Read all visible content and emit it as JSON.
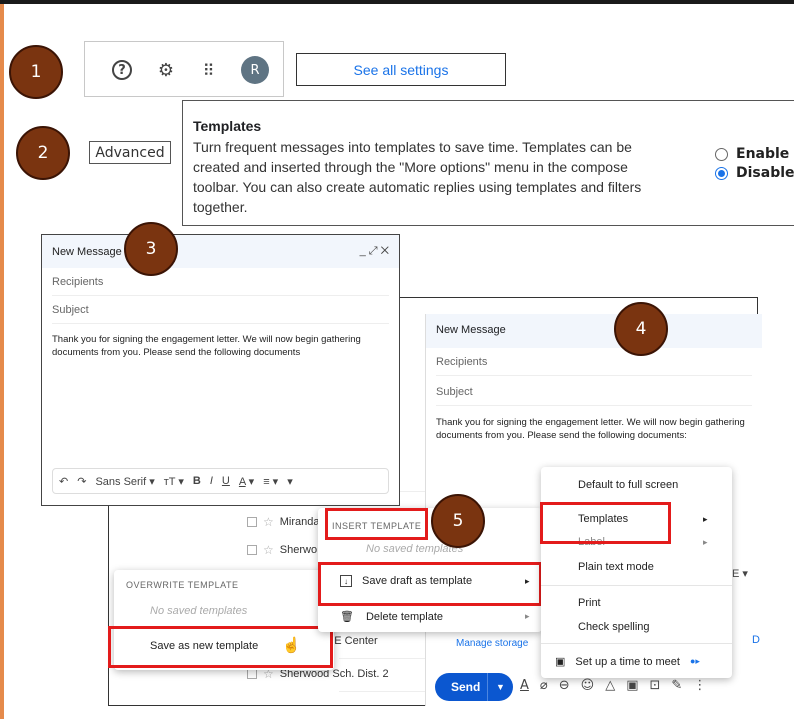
{
  "steps": [
    "1",
    "2",
    "3",
    "4",
    "5"
  ],
  "toolbar": {
    "avatar_letter": "R",
    "see_all_settings": "See all settings",
    "icons": [
      "help-icon",
      "gear-icon",
      "apps-grid-icon"
    ]
  },
  "settings": {
    "advanced_tab": "Advanced",
    "templates_title": "Templates",
    "templates_desc": "Turn frequent messages into templates to save time. Templates can be created and inserted through the \"More options\" menu in the compose toolbar. You can also create automatic replies using templates and filters together.",
    "enable_label": "Enable",
    "disable_label": "Disable",
    "selected": "Disable"
  },
  "compose": {
    "title": "New Message",
    "recipients_placeholder": "Recipients",
    "subject_placeholder": "Subject",
    "body": "Thank you for signing the engagement letter. We will now begin gathering documents from you. Please send the following documents",
    "body_full": "Thank you for signing the engagement letter. We will now begin gathering documents from you. Please send the following documents:",
    "window_controls": "_ ⤢ ✕",
    "format_toolbar": {
      "font": "Sans Serif",
      "bold": "B",
      "italic": "I",
      "underline": "U",
      "text_color": "A",
      "size": "тT"
    }
  },
  "inbox_list": {
    "rows": [
      "Miranda",
      "Sherwo",
      "ARE Center",
      "Sherwood Sch. Dist. 2"
    ]
  },
  "more_options_menu": {
    "items": [
      "Default to full screen",
      "Templates",
      "Label",
      "Plain text mode",
      "Print",
      "Check spelling",
      "Set up a time to meet"
    ]
  },
  "templates_menu": {
    "insert_header": "INSERT TEMPLATE",
    "insert_empty": "No saved templates",
    "save_draft": "Save draft as template",
    "delete_template": "Delete template",
    "manage_storage": "Manage storage"
  },
  "overwrite_menu": {
    "header": "OVERWRITE TEMPLATE",
    "empty": "No saved templates",
    "save_new": "Save as new template"
  },
  "send": {
    "label": "Send",
    "toolbar_partial_letter": "A",
    "partial_menu_glyph": "E",
    "partial_link_letter": "D"
  },
  "colors": {
    "step_circle": "#7a3410",
    "highlight": "#e31b1b",
    "accent": "#1a73e8",
    "send": "#0b57d0"
  }
}
